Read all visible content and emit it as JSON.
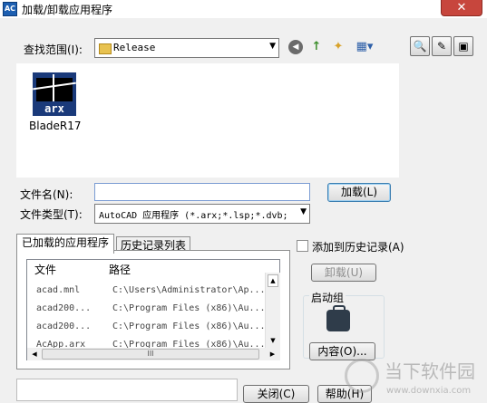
{
  "window": {
    "title": "加载/卸载应用程序",
    "app_icon_text": "AC",
    "close": "✕"
  },
  "lookin": {
    "label": "查找范围(I):",
    "value": "Release",
    "arrow": "▼"
  },
  "toolbar": {
    "back": "◀",
    "up": "↑",
    "new_folder": "✦",
    "views": "▦▾"
  },
  "right_buttons": {
    "search": "🔍",
    "props": "✎",
    "tools": "▣"
  },
  "files": [
    {
      "name": "BladeR17",
      "icon_text": "arx"
    }
  ],
  "filename": {
    "label": "文件名(N):",
    "value": ""
  },
  "load_button": "加载(L)",
  "filetype": {
    "label": "文件类型(T):",
    "value": "AutoCAD 应用程序 (*.arx;*.lsp;*.dvb;",
    "arrow": "▼"
  },
  "tabs": {
    "loaded": "已加载的应用程序",
    "history": "历史记录列表"
  },
  "table": {
    "headers": {
      "file": "文件",
      "path": "路径"
    },
    "rows": [
      {
        "file": "acad.mnl",
        "path": "C:\\Users\\Administrator\\Ap..."
      },
      {
        "file": "acad200...",
        "path": "C:\\Program Files (x86)\\Au..."
      },
      {
        "file": "acad200...",
        "path": "C:\\Program Files (x86)\\Au..."
      },
      {
        "file": "AcApp.arx",
        "path": "C:\\Program Files (x86)\\Au..."
      }
    ],
    "scroll_up": "▲",
    "scroll_down": "▼",
    "scroll_left": "◀",
    "scroll_right": "▶",
    "thumb": "III"
  },
  "add_history": "添加到历史记录(A)",
  "unload_button": "卸载(U)",
  "startup": {
    "label": "启动组",
    "contents_button": "内容(O)..."
  },
  "bottom": {
    "close": "关闭(C)",
    "help": "帮助(H)"
  },
  "watermark": {
    "text": "当下软件园",
    "url": "www.downxia.com"
  }
}
